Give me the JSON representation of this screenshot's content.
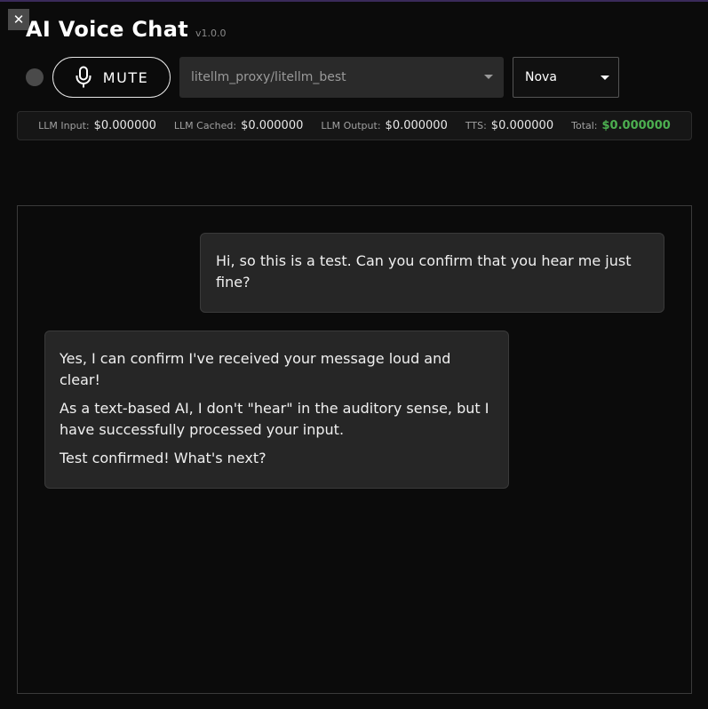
{
  "header": {
    "close_symbol": "✕",
    "title": "AI Voice Chat",
    "version": "v1.0.0"
  },
  "controls": {
    "mute_label": "MUTE",
    "model_value": "litellm_proxy/litellm_best",
    "voice_value": "Nova"
  },
  "costs": [
    {
      "label": "LLM Input:",
      "value": "$0.000000"
    },
    {
      "label": "LLM Cached:",
      "value": "$0.000000"
    },
    {
      "label": "LLM Output:",
      "value": "$0.000000"
    },
    {
      "label": "TTS:",
      "value": "$0.000000"
    },
    {
      "label": "Total:",
      "value": "$0.000000"
    }
  ],
  "messages": [
    {
      "role": "user",
      "paragraphs": [
        "Hi, so this is a test. Can you confirm that you hear me just fine?"
      ]
    },
    {
      "role": "assistant",
      "paragraphs": [
        "Yes, I can confirm I've received your message loud and clear!",
        "As a text-based AI, I don't \"hear\" in the auditory sense, but I have successfully processed your input.",
        "Test confirmed! What's next?"
      ]
    }
  ],
  "colors": {
    "background": "#0b0b0b",
    "total_accent": "#4caf50",
    "bubble": "#262626"
  },
  "icons": {
    "close": "close-icon",
    "mic": "microphone-icon",
    "dropdown": "chevron-down-icon",
    "status": "status-indicator"
  }
}
